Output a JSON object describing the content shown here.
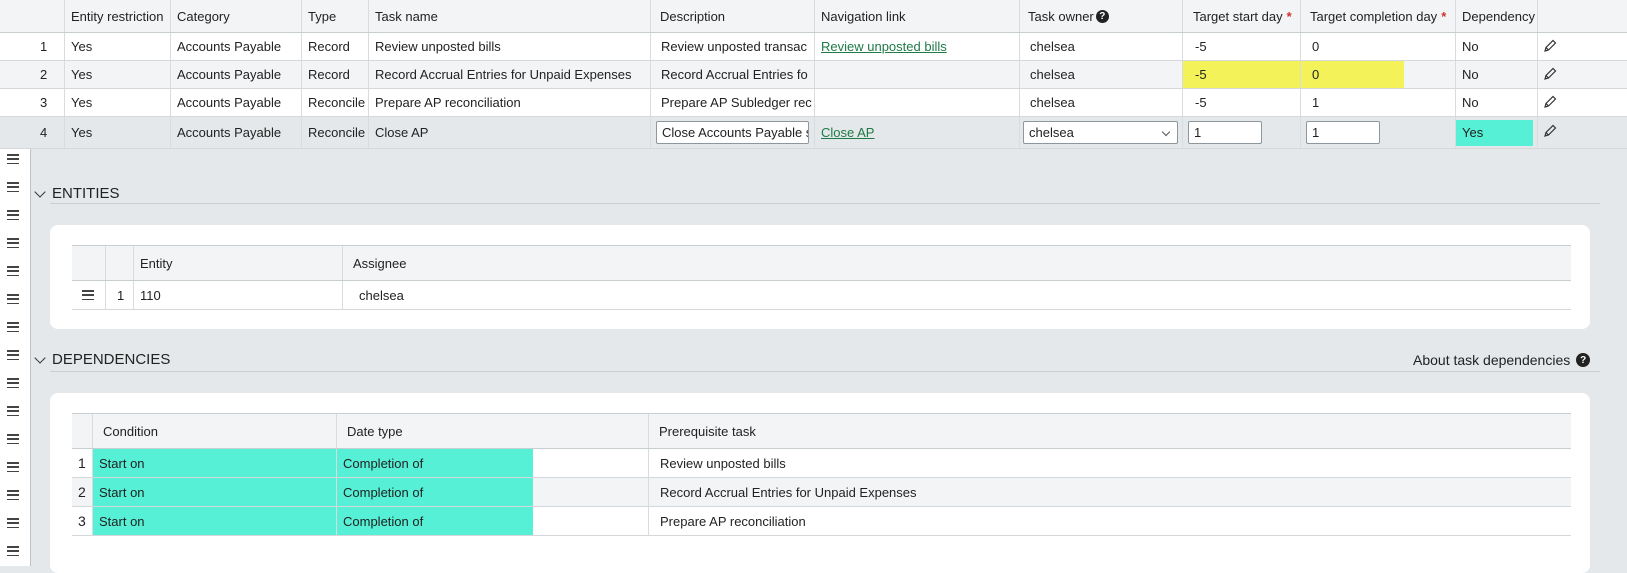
{
  "tasks_table": {
    "columns": {
      "entity_restriction": "Entity restriction",
      "category": "Category",
      "type": "Type",
      "task_name": "Task name",
      "description": "Description",
      "navigation_link": "Navigation link",
      "task_owner": "Task owner",
      "target_start_day": "Target start day",
      "target_completion_day": "Target completion day",
      "dependency": "Dependency"
    },
    "rows": [
      {
        "num": "1",
        "entity_restriction": "Yes",
        "category": "Accounts Payable",
        "type": "Record",
        "task_name": "Review unposted bills",
        "description": "Review unposted transac",
        "navigation_link": "Review unposted bills",
        "task_owner": "chelsea",
        "target_start_day": "-5",
        "target_completion_day": "0",
        "dependency": "No"
      },
      {
        "num": "2",
        "entity_restriction": "Yes",
        "category": "Accounts Payable",
        "type": "Record",
        "task_name": "Record Accrual Entries for Unpaid Expenses",
        "description": "Record Accrual Entries fo",
        "navigation_link": "",
        "task_owner": "chelsea",
        "target_start_day": "-5",
        "target_completion_day": "0",
        "dependency": "No"
      },
      {
        "num": "3",
        "entity_restriction": "Yes",
        "category": "Accounts Payable",
        "type": "Reconcile",
        "task_name": "Prepare AP reconciliation",
        "description": "Prepare AP Subledger rec",
        "navigation_link": "",
        "task_owner": "chelsea",
        "target_start_day": "-5",
        "target_completion_day": "1",
        "dependency": "No"
      },
      {
        "num": "4",
        "entity_restriction": "Yes",
        "category": "Accounts Payable",
        "type": "Reconcile",
        "task_name": "Close AP",
        "description": "Close Accounts Payable s",
        "navigation_link": "Close AP",
        "task_owner": "chelsea",
        "target_start_day": "1",
        "target_completion_day": "1",
        "dependency": "Yes"
      }
    ]
  },
  "entities": {
    "title": "ENTITIES",
    "columns": {
      "entity": "Entity",
      "assignee": "Assignee"
    },
    "rows": [
      {
        "num": "1",
        "entity": "110",
        "assignee": "chelsea"
      }
    ]
  },
  "dependencies": {
    "title": "DEPENDENCIES",
    "about_link": "About task dependencies",
    "columns": {
      "condition": "Condition",
      "date_type": "Date type",
      "prerequisite_task": "Prerequisite task"
    },
    "rows": [
      {
        "num": "1",
        "condition": "Start on",
        "date_type": "Completion of",
        "prerequisite_task": "Review unposted bills"
      },
      {
        "num": "2",
        "condition": "Start on",
        "date_type": "Completion of",
        "prerequisite_task": "Record Accrual Entries for Unpaid Expenses"
      },
      {
        "num": "3",
        "condition": "Start on",
        "date_type": "Completion of",
        "prerequisite_task": "Prepare AP reconciliation"
      }
    ]
  },
  "colors": {
    "highlight_yellow": "#f4f259",
    "highlight_cyan": "#55f0d6",
    "link_green": "#1e7a46"
  },
  "icons": [
    "drag-handle-icon",
    "pencil-icon",
    "help-icon",
    "chevron-down-icon"
  ]
}
